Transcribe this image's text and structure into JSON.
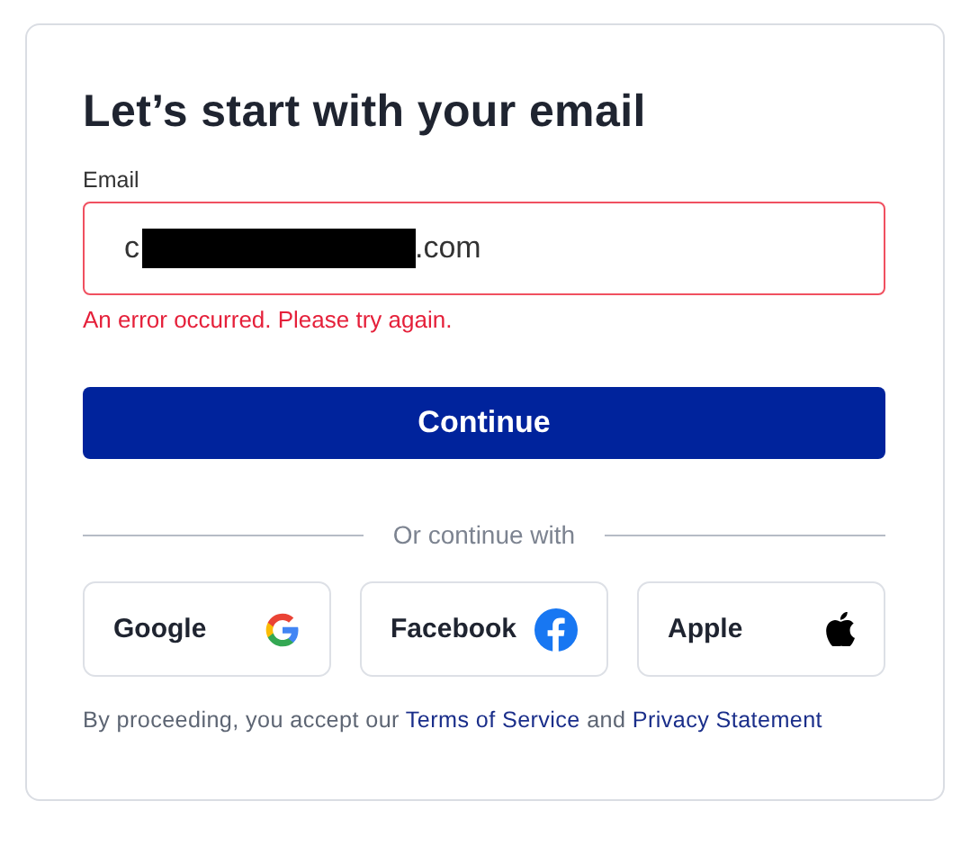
{
  "title": "Let’s start with your email",
  "email": {
    "label": "Email",
    "value_start": "c",
    "value_end": ".com",
    "redacted": true,
    "error": true,
    "error_message": "An error occurred. Please try again."
  },
  "continue_button": "Continue",
  "divider_text": "Or continue with",
  "social_buttons": [
    {
      "label": "Google",
      "kind": "google"
    },
    {
      "label": "Facebook",
      "kind": "facebook"
    },
    {
      "label": "Apple",
      "kind": "apple"
    }
  ],
  "footer": {
    "text_before": "By proceeding, you accept our ",
    "terms_link": "Terms of Service",
    "text_between": " and ",
    "privacy_link": "Privacy Statement"
  }
}
